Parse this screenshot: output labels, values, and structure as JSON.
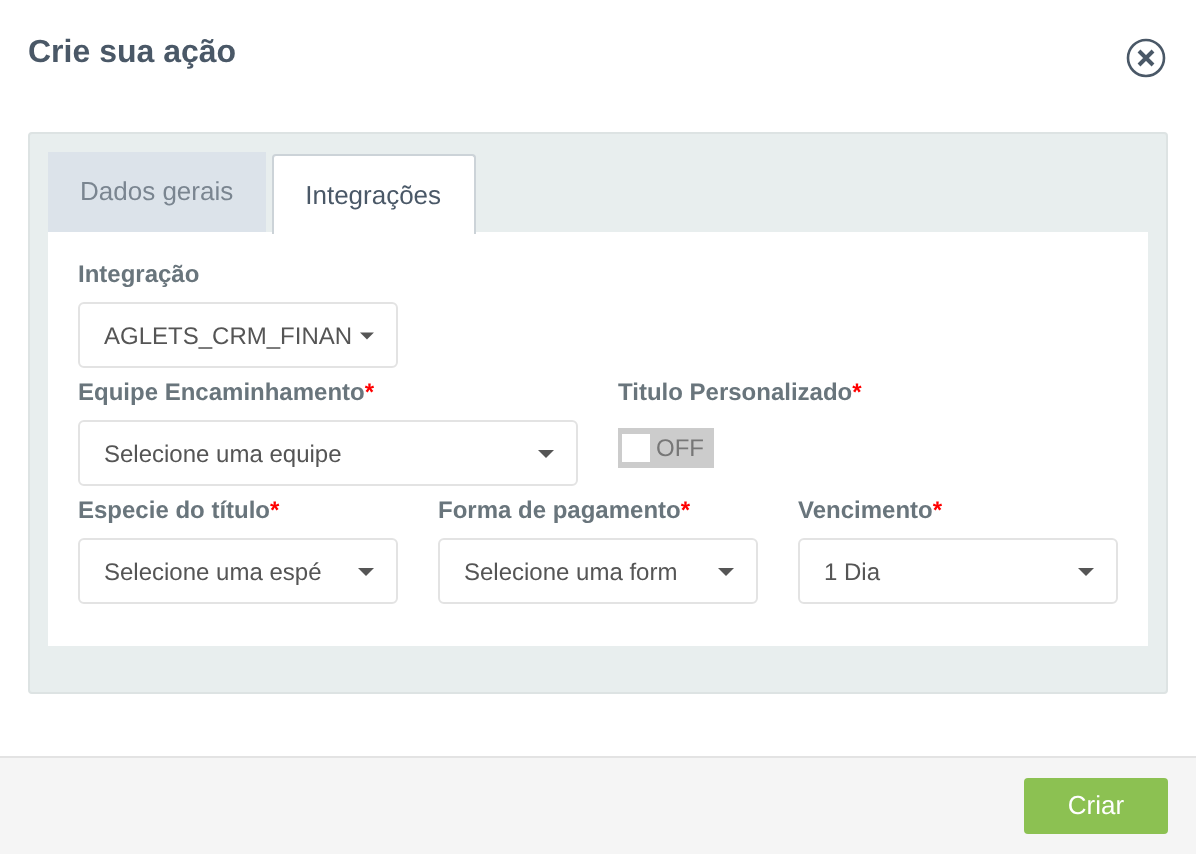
{
  "dialog": {
    "title": "Crie sua ação"
  },
  "tabs": [
    {
      "label": "Dados gerais",
      "selected": false
    },
    {
      "label": "Integrações",
      "selected": true
    }
  ],
  "fields": [
    {
      "kind": "select",
      "label": "Integração",
      "value": "AGLETS_CRM_FINAN"
    },
    {
      "kind": "select",
      "label": "Equipe Encaminhamento",
      "required_mark": "*",
      "value": "Selecione uma equipe"
    },
    {
      "kind": "toggle",
      "label": "Titulo Personalizado",
      "required_mark": "*",
      "on": false,
      "state_text": "OFF"
    },
    {
      "kind": "select",
      "label": "Especie do título",
      "required_mark": "*",
      "value": "Selecione uma espé"
    },
    {
      "kind": "select",
      "label": "Forma de pagamento",
      "required_mark": "*",
      "value": "Selecione uma form"
    },
    {
      "kind": "select",
      "label": "Vencimento",
      "required_mark": "*",
      "value": "1 Dia"
    }
  ],
  "footer": {
    "button": "Criar"
  }
}
